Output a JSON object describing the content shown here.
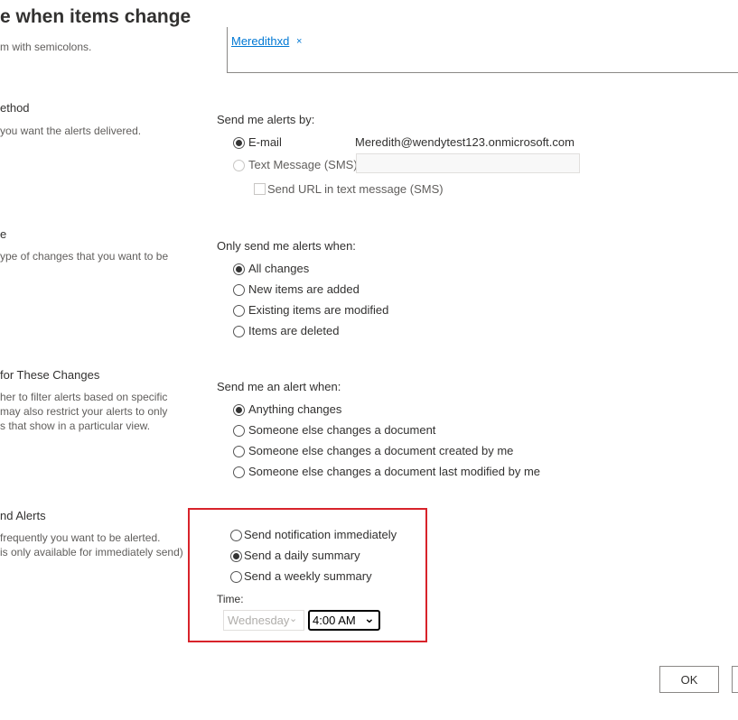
{
  "page": {
    "title": "e when items change"
  },
  "users_section": {
    "desc": "m with semicolons.",
    "token_text": "Meredithxd",
    "token_remove": "×"
  },
  "delivery": {
    "heading": "ethod",
    "desc": "you want the alerts delivered.",
    "label": "Send me alerts by:",
    "email_label": "E-mail",
    "email_value": "Meredith@wendytest123.onmicrosoft.com",
    "sms_label": "Text Message (SMS)",
    "sms_value": "",
    "url_label": "Send URL in text message (SMS)"
  },
  "change_type": {
    "heading": "e",
    "desc": "ype of changes that you want to be",
    "label": "Only send me alerts when:",
    "options": [
      "All changes",
      "New items are added",
      "Existing items are modified",
      "Items are deleted"
    ],
    "selected": 0
  },
  "filter": {
    "heading": " for These Changes",
    "desc_lines": [
      "her to filter alerts based on specific",
      "may also restrict your alerts to only",
      "s that show in a particular view."
    ],
    "label": "Send me an alert when:",
    "options": [
      "Anything changes",
      "Someone else changes a document",
      "Someone else changes a document created by me",
      "Someone else changes a document last modified by me"
    ],
    "selected": 0
  },
  "when": {
    "heading": "nd Alerts",
    "desc_lines": [
      "frequently you want to be alerted.",
      " is only available for immediately send)"
    ],
    "options": [
      "Send notification immediately",
      "Send a daily summary",
      "Send a weekly summary"
    ],
    "selected": 1,
    "time_label": "Time:",
    "day_value": "Wednesday",
    "time_value": "4:00 AM",
    "highlight_color": "#d8232a"
  },
  "buttons": {
    "ok": "OK"
  }
}
